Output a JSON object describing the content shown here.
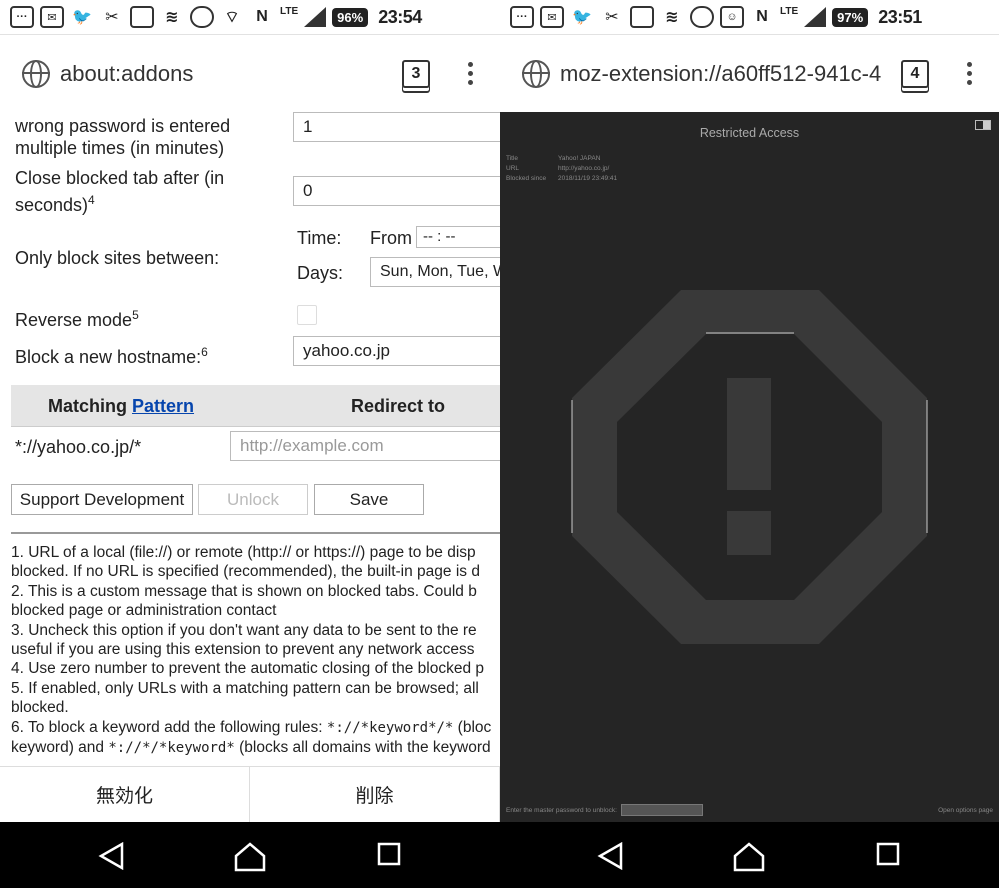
{
  "left": {
    "status": {
      "battery": "96%",
      "time": "23:54",
      "network": "LTE"
    },
    "toolbar": {
      "url": "about:addons",
      "tab_count": "3"
    },
    "settings": {
      "wrong_password_label_line1": "wrong password is entered",
      "wrong_password_label_line2": "multiple times (in minutes)",
      "wrong_password_value": "1",
      "close_tab_label_line1": "Close blocked tab after (in",
      "close_tab_label_line2": "seconds)",
      "close_tab_sup": "4",
      "close_tab_value": "0",
      "only_block_label": "Only block sites between:",
      "time_label": "Time:",
      "from_label": "From",
      "time_from_placeholder": "-- : --",
      "days_label": "Days:",
      "days_value": "Sun, Mon, Tue, W",
      "reverse_mode_label": "Reverse mode",
      "reverse_mode_sup": "5",
      "block_hostname_label": "Block a new hostname:",
      "block_hostname_sup": "6",
      "block_hostname_value": "yahoo.co.jp"
    },
    "table": {
      "col_matching": "Matching",
      "col_pattern_link": "Pattern",
      "col_redirect": "Redirect to",
      "rows": [
        {
          "pattern": "*://yahoo.co.jp/*",
          "redirect_placeholder": "http://example.com"
        }
      ]
    },
    "buttons": {
      "support": "Support Development",
      "unlock": "Unlock",
      "save": "Save"
    },
    "notes": [
      "1. URL of a local (file://) or remote (http:// or https://) page to be disp",
      "blocked. If no URL is specified (recommended), the built-in page is d",
      "2. This is a custom message that is shown on blocked tabs. Could b",
      "blocked page or administration contact",
      "3. Uncheck this option if you don't want any data to be sent to the re",
      "useful if you are using this extension to prevent any network access",
      "4. Use zero number to prevent the automatic closing of the blocked p",
      "5. If enabled, only URLs with a matching pattern can be browsed; all",
      "blocked.",
      "6. To block a keyword add the following rules: ",
      "keyword) and "
    ],
    "note6_code1": "*://*keyword*/*",
    "note6_tail": " (bloc",
    "note6b_code": "*://*/*keyword*",
    "note6b_tail": " (blocks all domains with the keyword",
    "actions": {
      "disable": "無効化",
      "remove": "削除"
    }
  },
  "right": {
    "status": {
      "battery": "97%",
      "time": "23:51",
      "network": "LTE"
    },
    "toolbar": {
      "url": "moz-extension://a60ff512-941c-4",
      "tab_count": "4"
    },
    "page": {
      "title": "Restricted Access",
      "info_title_key": "Title",
      "info_title_val": "Yahoo! JAPAN",
      "info_url_key": "URL",
      "info_url_val": "http://yahoo.co.jp/",
      "info_date_key": "Blocked since",
      "info_date_val": "2018/11/19 23:49:41",
      "password_prompt": "Enter the master password to unblock:",
      "open_options": "Open options page"
    }
  }
}
